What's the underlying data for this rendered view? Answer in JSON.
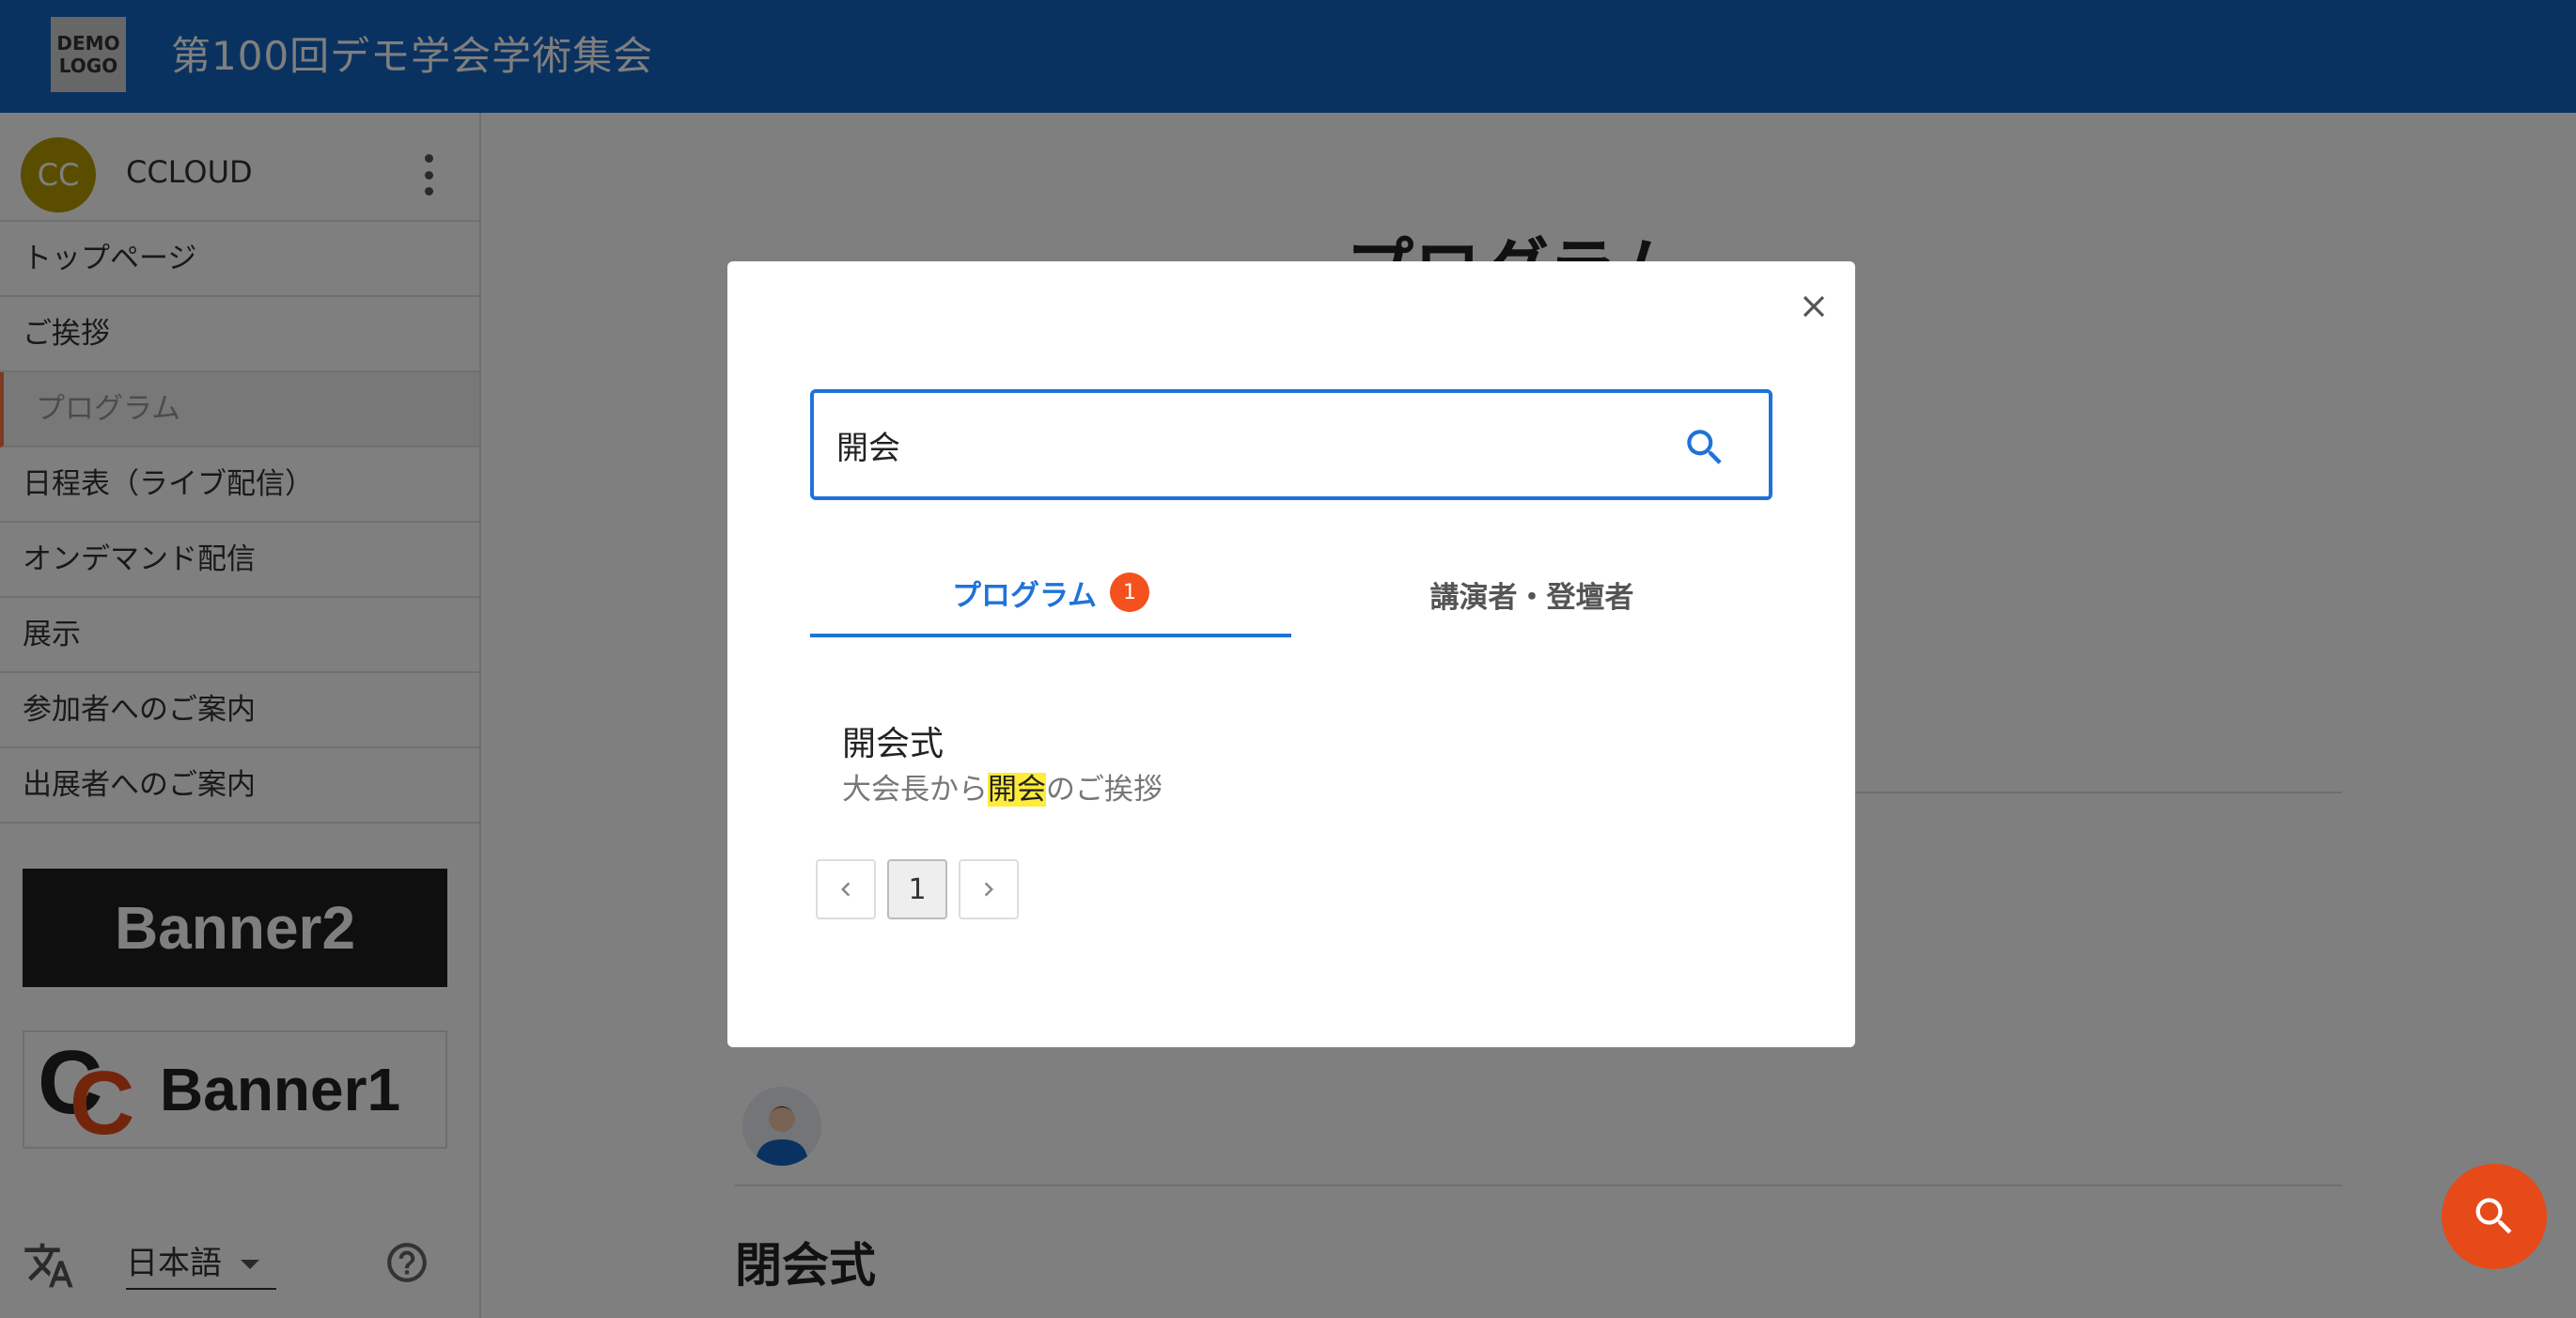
{
  "header": {
    "logo_text": "DEMO\nLOGO",
    "site_title": "第100回デモ学会学術集会"
  },
  "sidebar": {
    "user": {
      "initials": "CC",
      "name": "CCLOUD"
    },
    "items": [
      {
        "label": "トップページ"
      },
      {
        "label": "ご挨拶"
      },
      {
        "label": "プログラム",
        "active": true
      },
      {
        "label": "日程表（ライブ配信）"
      },
      {
        "label": "オンデマンド配信"
      },
      {
        "label": "展示"
      },
      {
        "label": "参加者へのご案内"
      },
      {
        "label": "出展者へのご案内"
      }
    ],
    "banners": [
      {
        "label": "Banner2"
      },
      {
        "label": "Banner1",
        "mark_letters": [
          "C",
          "C"
        ]
      }
    ],
    "language": {
      "selected": "日本語"
    }
  },
  "main": {
    "heading": "プログラム",
    "subheading": "閉会式"
  },
  "search_modal": {
    "query": "開会",
    "tabs": [
      {
        "label": "プログラム",
        "count": "1",
        "active": true
      },
      {
        "label": "講演者・登壇者",
        "active": false
      }
    ],
    "results": [
      {
        "title": "開会式",
        "desc_before": "大会長から",
        "desc_highlight": "開会",
        "desc_after": "のご挨拶"
      }
    ],
    "pagination": {
      "current": "1"
    }
  },
  "colors": {
    "header_bg": "#1565c0",
    "accent_blue": "#1e73d8",
    "accent_orange": "#e64a19",
    "highlight": "#ffeb3b"
  },
  "icons": {
    "search": "search-icon",
    "close": "close-icon",
    "kebab": "more-vert-icon",
    "translate": "translate-icon",
    "help": "help-icon",
    "prev": "chevron-left-icon",
    "next": "chevron-right-icon"
  }
}
